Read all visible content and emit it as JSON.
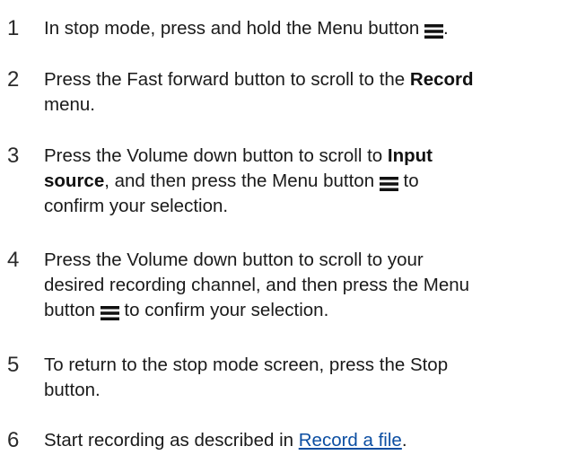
{
  "steps": [
    {
      "number": "1",
      "lines": [
        {
          "t1": "In stop mode, press and hold the Menu button ",
          "icon": "menu-icon",
          "t2": "."
        }
      ]
    },
    {
      "number": "2",
      "lines": [
        {
          "t1": "Press the Fast forward button to scroll to the ",
          "bold": "Record"
        },
        {
          "t1": "menu."
        }
      ]
    },
    {
      "number": "3",
      "lines": [
        {
          "t1": "Press the Volume down button to scroll to ",
          "bold": "Input"
        },
        {
          "bold": "source",
          "t1": ", and then press the Menu button ",
          "icon": "menu-icon",
          "t2": " to"
        },
        {
          "t1": "confirm your selection."
        }
      ]
    },
    {
      "number": "4",
      "lines": [
        {
          "t1": "Press the Volume down button to scroll to your"
        },
        {
          "t1": "desired recording channel, and then press the Menu"
        },
        {
          "t1": "button ",
          "icon": "menu-icon",
          "t2": " to confirm your selection."
        }
      ]
    },
    {
      "number": "5",
      "lines": [
        {
          "t1": "To return to the stop mode screen, press the Stop"
        },
        {
          "t1": "button."
        }
      ]
    },
    {
      "number": "6",
      "lines": [
        {
          "t1": "Start recording as described in ",
          "link": "Record a file",
          "t2": "."
        }
      ]
    }
  ],
  "colors": {
    "text": "#1a1a1a",
    "link": "#0b4ea2"
  }
}
